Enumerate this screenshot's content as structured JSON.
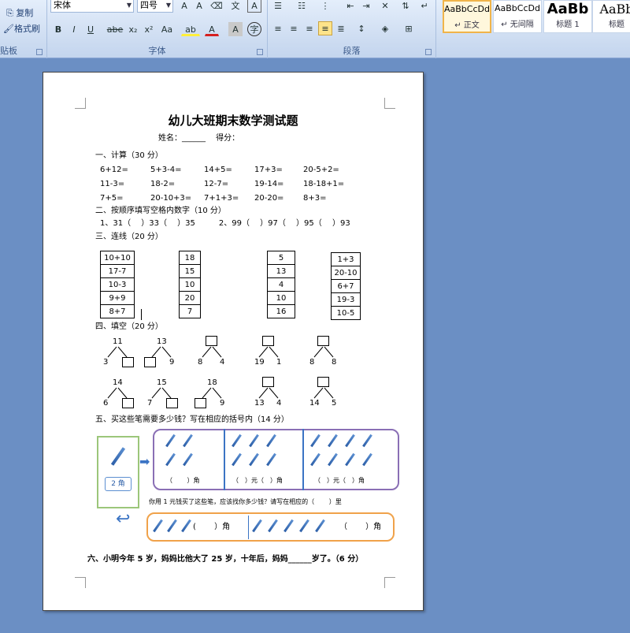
{
  "ribbon": {
    "clipboard": {
      "copy_label": "复制",
      "format_painter_label": "格式刷",
      "group_label": "贴板"
    },
    "font": {
      "font_name": "宋体",
      "font_size": "四号",
      "group_label": "字体",
      "buttons": [
        "B",
        "I",
        "U",
        "abe",
        "x₂",
        "x²",
        "Aa"
      ]
    },
    "paragraph": {
      "group_label": "段落"
    },
    "styles": [
      {
        "sample": "AaBbCcDd",
        "name": "↵ 正文"
      },
      {
        "sample": "AaBbCcDd",
        "name": "↵ 无间隔"
      },
      {
        "sample": "AaBb",
        "name": "标题 1"
      },
      {
        "sample": "AaBb",
        "name": "标题"
      }
    ]
  },
  "doc": {
    "title": "幼儿大班期末数学测试题",
    "name_line": "姓名：______　 得分：",
    "s1": "一、计算（30 分）",
    "calc_rows": [
      [
        "6+12=",
        "5+3-4=",
        "14+5=",
        "17+3=",
        "20-5+2="
      ],
      [
        "11-3=",
        "18-2=",
        "12-7=",
        "19-14=",
        "18-18+1="
      ],
      [
        "7+5=",
        "20-10+3=",
        "7+1+3=",
        "20-20=",
        "8+3="
      ]
    ],
    "s2": "二、按顺序填写空格内数字（10 分）",
    "s2_line": "1、31（　 ）33（　 ）35　　　2、99（　 ）97（　 ）95（　 ）93",
    "s3": "三、连线（20 分）",
    "col1": [
      "10+10",
      "17-7",
      "10-3",
      "9+9",
      "8+7"
    ],
    "col2": [
      "18",
      "15",
      "10",
      "20",
      "7"
    ],
    "col3": [
      "5",
      "13",
      "4",
      "10",
      "16"
    ],
    "col4": [
      "1+3",
      "20-10",
      "6+7",
      "19-3",
      "10-5"
    ],
    "s4": "四、填空（20 分）",
    "trees_row1": [
      {
        "top": "11",
        "left": "3",
        "right": ""
      },
      {
        "top": "13",
        "left": "",
        "right": "9"
      },
      {
        "top": "",
        "left": "8",
        "right": "4"
      },
      {
        "top": "",
        "left": "19",
        "right": "1"
      },
      {
        "top": "",
        "left": "8",
        "right": "8"
      }
    ],
    "trees_row2": [
      {
        "top": "14",
        "left": "6",
        "right": ""
      },
      {
        "top": "15",
        "left": "7",
        "right": ""
      },
      {
        "top": "18",
        "left": "",
        "right": "9"
      },
      {
        "top": "",
        "left": "13",
        "right": "4"
      },
      {
        "top": "",
        "left": "14",
        "right": "5"
      }
    ],
    "s5": "五、买这些笔需要多少钱？写在相应的括号内（14 分）",
    "price_tag": "2 角",
    "panel_labels": [
      "（　　 ）角",
      "（　）元（　）角",
      "（　）元（　）角"
    ],
    "s5_q2": "你用 1 元钱买了这些笔，应该找你多少钱？请写在相应的（　　 ）里",
    "change_labels": [
      "(　　 ）角",
      "（　　 ）角"
    ],
    "s6": "六、小明今年 5 岁，妈妈比他大了 25 岁，十年后，妈妈______岁了。（6 分）"
  },
  "colors": {
    "workspace": "#6b8fc4",
    "panel_purple": "#8a6fb5",
    "panel_orange": "#f0a24a",
    "pencil": "#3b74c4"
  }
}
